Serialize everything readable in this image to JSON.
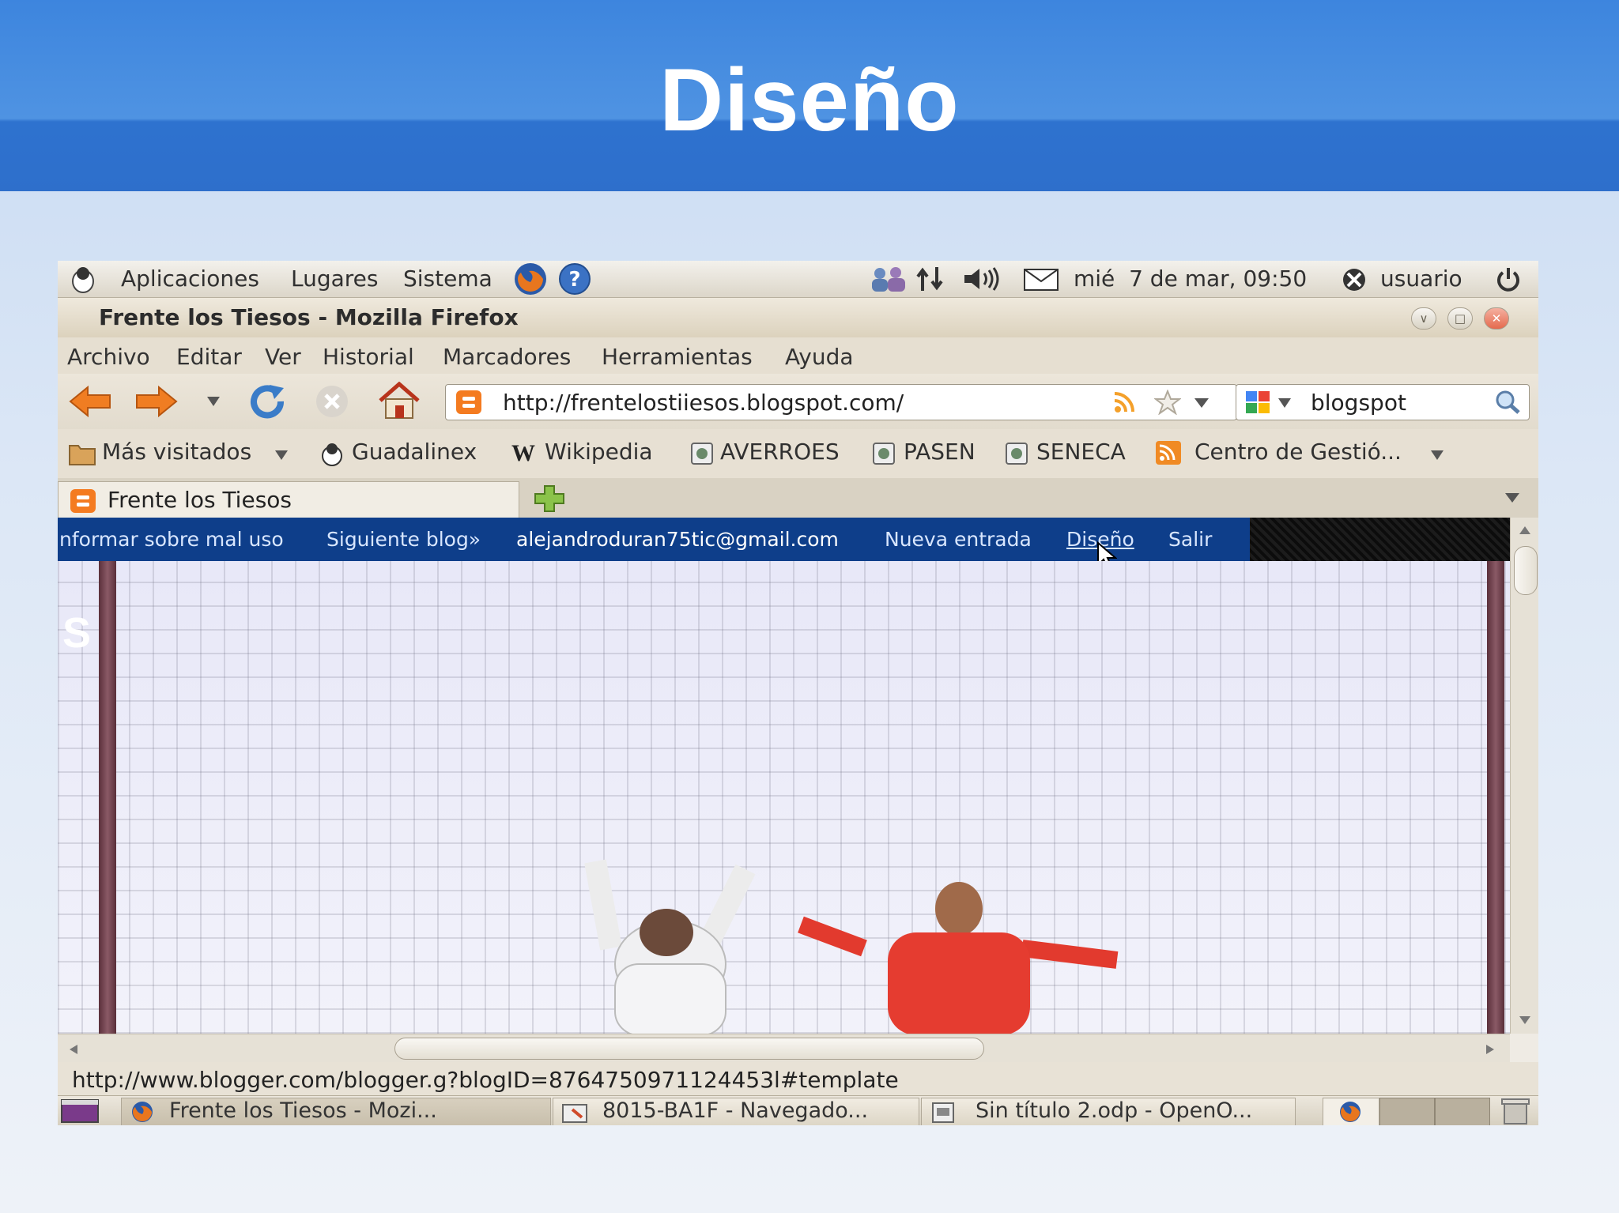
{
  "slide": {
    "title": "Diseño"
  },
  "panel": {
    "menus": [
      "Aplicaciones",
      "Lugares",
      "Sistema"
    ],
    "clock": "mié  7 de mar, 09:50",
    "user": "usuario"
  },
  "window": {
    "title": "Frente los Tiesos - Mozilla Firefox"
  },
  "menubar": {
    "items": [
      "Archivo",
      "Editar",
      "Ver",
      "Historial",
      "Marcadores",
      "Herramientas",
      "Ayuda"
    ]
  },
  "navigation": {
    "url": "http://frentelostiiesos.blogspot.com/",
    "search_value": "blogspot"
  },
  "bookmarks": {
    "items": [
      "Más visitados",
      "Guadalinex",
      "Wikipedia",
      "AVERROES",
      "PASEN",
      "SENECA",
      "Centro de Gestió..."
    ]
  },
  "tabs": {
    "active_label": "Frente los Tiesos"
  },
  "blogger_bar": {
    "report": "nformar sobre mal uso",
    "next_blog": "Siguiente blog»",
    "email": "alejandroduran75tic@gmail.com",
    "new_post": "Nueva entrada",
    "design": "Diseño",
    "logout": "Salir"
  },
  "statusbar": {
    "text": "http://www.blogger.com/blogger.g?blogID=8764750971124453l#template"
  },
  "taskbar": {
    "items": [
      "Frente los Tiesos - Mozi...",
      "8015-BA1F - Navegado...",
      "Sin título 2.odp - OpenO..."
    ]
  },
  "colors": {
    "slide_header": "#3d85de",
    "blogger_bar": "#0e3e8a",
    "blogger_link": "#d8e6ff",
    "gnome_panel": "#e6dfd1"
  }
}
